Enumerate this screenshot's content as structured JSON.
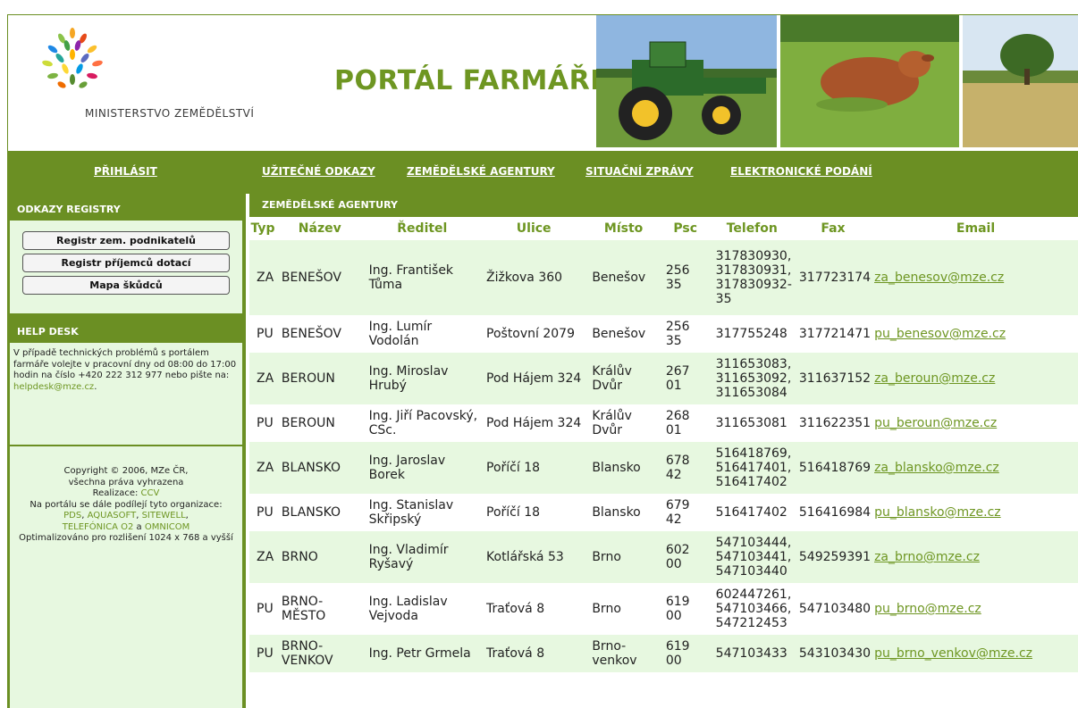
{
  "header": {
    "title": "PORTÁL FARMÁŘE",
    "ministry": "MINISTERSTVO ZEMĚDĚLSTVÍ"
  },
  "nav": {
    "login": "PŘIHLÁSIT",
    "links": "UŽITEČNÉ ODKAZY",
    "agencies": "ZEMĚDĚLSKÉ AGENTURY",
    "reports": "SITUAČNÍ ZPRÁVY",
    "filing": "ELEKTRONICKÉ PODÁNÍ"
  },
  "sidebar": {
    "registry_title": "ODKAZY REGISTRY",
    "buttons": [
      "Registr zem. podnikatelů",
      "Registr příjemců dotací",
      "Mapa škůdců"
    ],
    "helpdesk_title": "HELP DESK",
    "helpdesk_text": "V případě technických problémů s portálem farmáře volejte v pracovní dny od 08:00 do 17:00 hodin na číslo +420 222 312 977 nebo pište na:",
    "helpdesk_email": "helpdesk@mze.cz",
    "copyright_line1": "Copyright © 2006, MZe ČR,",
    "copyright_line2": "všechna práva vyhrazena",
    "realization_label": "Realizace:",
    "realization": "CCV",
    "partners_label": "Na portálu se dále podílejí tyto organizace:",
    "partner1": "PDS",
    "partner2": "AQUASOFT",
    "partner3": "SITEWELL",
    "partner4": "TELEFÓNICA O2",
    "partner_and": "a",
    "partner5": "OMNICOM",
    "optimized": "Optimalizováno pro rozlišení 1024 x 768 a vyšší"
  },
  "main": {
    "section_title": "ZEMĚDĚLSKÉ AGENTURY",
    "columns": [
      "Typ",
      "Název",
      "Ředitel",
      "Ulice",
      "Místo",
      "Psc",
      "Telefon",
      "Fax",
      "Email"
    ],
    "rows": [
      {
        "typ": "ZA",
        "nazev": "BENEŠOV",
        "reditel": "Ing. František Tůma",
        "ulice": "Žižkova 360",
        "misto": "Benešov",
        "psc": "256 35",
        "telefon": "317830930, 317830931, 317830932-35",
        "fax": "317723174",
        "email": "za_benesov@mze.cz"
      },
      {
        "typ": "PU",
        "nazev": "BENEŠOV",
        "reditel": "Ing. Lumír Vodolán",
        "ulice": "Poštovní 2079",
        "misto": "Benešov",
        "psc": "256 35",
        "telefon": "317755248",
        "fax": "317721471",
        "email": "pu_benesov@mze.cz"
      },
      {
        "typ": "ZA",
        "nazev": "BEROUN",
        "reditel": "Ing. Miroslav Hrubý",
        "ulice": "Pod Hájem 324",
        "misto": "Králův Dvůr",
        "psc": "267 01",
        "telefon": "311653083, 311653092, 311653084",
        "fax": "311637152",
        "email": "za_beroun@mze.cz"
      },
      {
        "typ": "PU",
        "nazev": "BEROUN",
        "reditel": "Ing. Jiří Pacovský, CSc.",
        "ulice": "Pod Hájem 324",
        "misto": "Králův Dvůr",
        "psc": "268 01",
        "telefon": "311653081",
        "fax": "311622351",
        "email": "pu_beroun@mze.cz"
      },
      {
        "typ": "ZA",
        "nazev": "BLANSKO",
        "reditel": "Ing. Jaroslav Borek",
        "ulice": "Poříčí 18",
        "misto": "Blansko",
        "psc": "678 42",
        "telefon": "516418769, 516417401, 516417402",
        "fax": "516418769",
        "email": "za_blansko@mze.cz"
      },
      {
        "typ": "PU",
        "nazev": "BLANSKO",
        "reditel": "Ing. Stanislav Skřipský",
        "ulice": "Poříčí 18",
        "misto": "Blansko",
        "psc": "679 42",
        "telefon": "516417402",
        "fax": "516416984",
        "email": "pu_blansko@mze.cz"
      },
      {
        "typ": "ZA",
        "nazev": "BRNO",
        "reditel": "Ing. Vladimír Ryšavý",
        "ulice": "Kotlářská 53",
        "misto": "Brno",
        "psc": "602 00",
        "telefon": "547103444, 547103441, 547103440",
        "fax": "549259391",
        "email": "za_brno@mze.cz"
      },
      {
        "typ": "PU",
        "nazev": "BRNO-MĚSTO",
        "reditel": "Ing. Ladislav Vejvoda",
        "ulice": "Traťová 8",
        "misto": "Brno",
        "psc": "619 00",
        "telefon": "602447261, 547103466, 547212453",
        "fax": "547103480",
        "email": "pu_brno@mze.cz"
      },
      {
        "typ": "PU",
        "nazev": "BRNO-VENKOV",
        "reditel": "Ing. Petr Grmela",
        "ulice": "Traťová 8",
        "misto": "Brno-venkov",
        "psc": "619 00",
        "telefon": "547103433",
        "fax": "543103430",
        "email": "pu_brno_venkov@mze.cz"
      }
    ]
  },
  "colors": {
    "green": "#6b8f23",
    "light": "#e7f8e0",
    "title": "#6e9622"
  }
}
